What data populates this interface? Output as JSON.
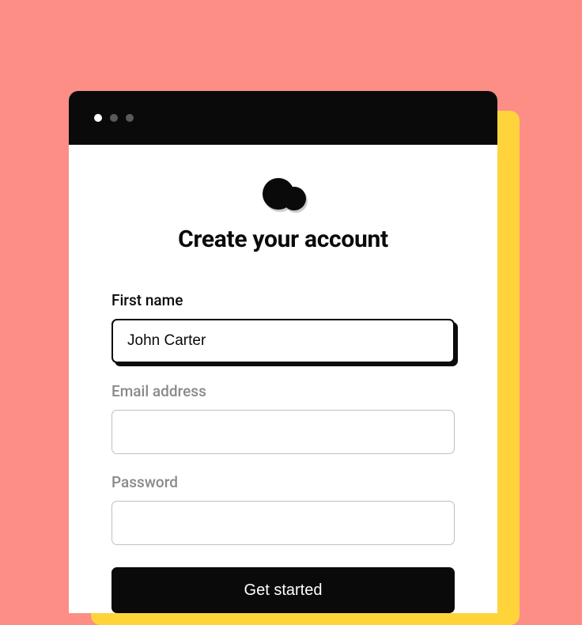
{
  "form": {
    "title": "Create your account",
    "fields": {
      "first_name": {
        "label": "First name",
        "value": "John Carter"
      },
      "email": {
        "label": "Email address",
        "value": ""
      },
      "password": {
        "label": "Password",
        "value": ""
      }
    },
    "submit_label": "Get started"
  }
}
